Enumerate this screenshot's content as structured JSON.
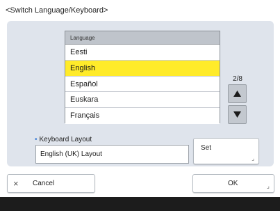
{
  "screen": {
    "title": "<Switch Language/Keyboard>"
  },
  "language_list": {
    "header": "Language",
    "items": [
      "Eesti",
      "English",
      "Español",
      "Euskara",
      "Français"
    ],
    "selected": "English",
    "page_indicator": "2/8"
  },
  "keyboard": {
    "label": "Keyboard Layout",
    "value": "English (UK) Layout",
    "set_label": "Set"
  },
  "buttons": {
    "cancel_label": "Cancel",
    "ok_label": "OK"
  },
  "colors": {
    "selected_highlight": "#ffeb2a",
    "panel_background": "#dfe4ec",
    "footer_bar": "#1c1c1c"
  }
}
